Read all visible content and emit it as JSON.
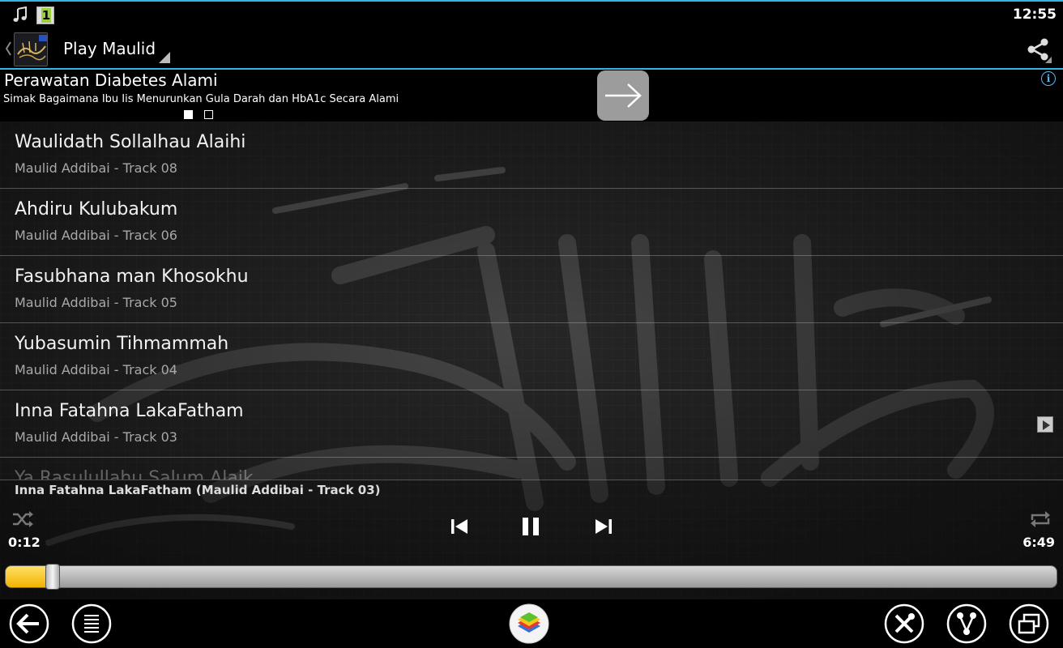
{
  "status_bar": {
    "time": "12:55",
    "notification_badge": "1"
  },
  "action_bar": {
    "title": "Play Maulid"
  },
  "ad": {
    "title": "Perawatan Diabetes Alami",
    "description": "Simak Bagaimana Ibu Iis Menurunkan Gula Darah dan HbA1c Secara Alami",
    "info_label": "i"
  },
  "tracks": [
    {
      "title": "Waulidath Sollalhau Alaihi",
      "subtitle": "Maulid Addibai - Track 08"
    },
    {
      "title": "Ahdiru Kulubakum",
      "subtitle": "Maulid Addibai - Track 06"
    },
    {
      "title": "Fasubhana man Khosokhu",
      "subtitle": "Maulid Addibai - Track 05"
    },
    {
      "title": "Yubasumin Tihmammah",
      "subtitle": "Maulid Addibai - Track 04"
    },
    {
      "title": "Inna Fatahna LakaFatham",
      "subtitle": "Maulid Addibai - Track 03"
    },
    {
      "title": "Ya Rasulullahu Salum Alaik",
      "subtitle": ""
    }
  ],
  "player": {
    "now_playing": "Inna Fatahna LakaFatham (Maulid Addibai - Track 03)",
    "elapsed": "0:12",
    "total": "6:49",
    "progress": 0.038
  },
  "colors": {
    "accent": "#33b5e5",
    "seek_fill": "#f2b300"
  },
  "icons": {
    "status": [
      "music-note-icon",
      "notification-icon"
    ],
    "action_bar": [
      "back-caret-icon",
      "app-icon",
      "spinner-icon",
      "share-icon"
    ],
    "player": [
      "shuffle-icon",
      "previous-icon",
      "pause-icon",
      "next-icon",
      "repeat-icon"
    ],
    "nav": [
      "back-icon",
      "menu-icon",
      "bluestacks-icon",
      "tools-icon",
      "share-nodes-icon",
      "window-icon"
    ]
  }
}
